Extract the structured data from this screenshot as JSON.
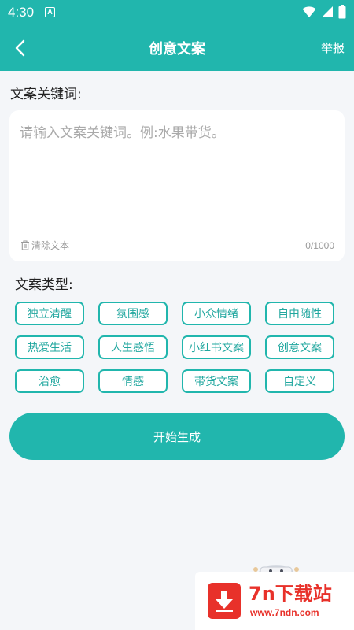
{
  "status_bar": {
    "time": "4:30",
    "notification_badge": "A"
  },
  "header": {
    "title": "创意文案",
    "report_label": "举报"
  },
  "keywords": {
    "label": "文案关键词:",
    "value": "",
    "placeholder": "请输入文案关键词。例:水果带货。",
    "clear_label": "清除文本",
    "char_count": "0/1000"
  },
  "types": {
    "label": "文案类型:",
    "items": [
      "独立清醒",
      "氛围感",
      "小众情绪",
      "自由随性",
      "热爱生活",
      "人生感悟",
      "小红书文案",
      "创意文案",
      "治愈",
      "情感",
      "带货文案",
      "自定义"
    ]
  },
  "start_button": {
    "label": "开始生成"
  },
  "watermark": {
    "name": "7n下载站",
    "url": "www.7ndn.com"
  },
  "colors": {
    "accent": "#21b6ad",
    "background": "#f4f6f9",
    "watermark_red": "#e8312a"
  }
}
